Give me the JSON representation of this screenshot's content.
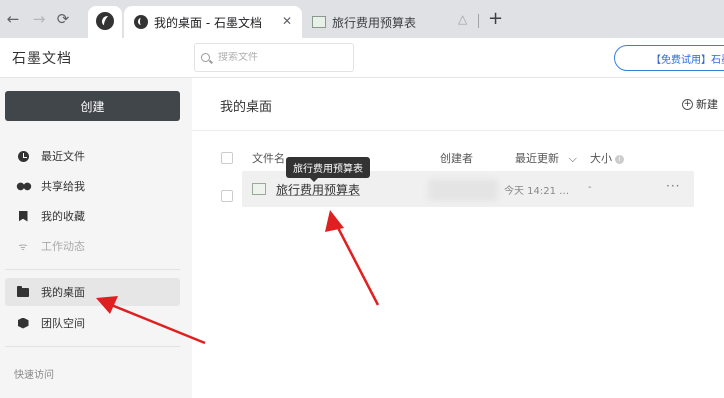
{
  "browser": {
    "tabs": [
      {
        "title": "我的桌面 - 石墨文档",
        "active": true
      },
      {
        "title": "旅行费用预算表",
        "active": false
      }
    ],
    "close_glyph": "✕",
    "new_tab_glyph": "+"
  },
  "app": {
    "brand": "石墨文档",
    "search_placeholder": "搜索文件",
    "trial_button": "【免费试用】石墨"
  },
  "sidebar": {
    "create_label": "创建",
    "items": [
      {
        "label": "最近文件",
        "icon": "clock-icon",
        "active": false,
        "disabled": false
      },
      {
        "label": "共享给我",
        "icon": "people-icon",
        "active": false,
        "disabled": false
      },
      {
        "label": "我的收藏",
        "icon": "bookmark-icon",
        "active": false,
        "disabled": false
      },
      {
        "label": "工作动态",
        "icon": "rss-icon",
        "active": false,
        "disabled": true
      },
      {
        "label": "我的桌面",
        "icon": "desktop-icon",
        "active": true,
        "disabled": false
      },
      {
        "label": "团队空间",
        "icon": "cube-icon",
        "active": false,
        "disabled": false
      }
    ],
    "quick_access_label": "快速访问"
  },
  "main": {
    "title": "我的桌面",
    "new_button": "新建",
    "columns": {
      "name": "文件名",
      "creator": "创建者",
      "modified": "最近更新",
      "size": "大小"
    },
    "files": [
      {
        "name": "旅行费用预算表",
        "modified": "今天 14:21 …",
        "size": "-"
      }
    ],
    "tooltip": "旅行费用预算表",
    "more_glyph": "···"
  },
  "colors": {
    "annotation_arrow": "#e02020",
    "create_button": "#41464b",
    "trial_border": "#3a7fe0"
  }
}
